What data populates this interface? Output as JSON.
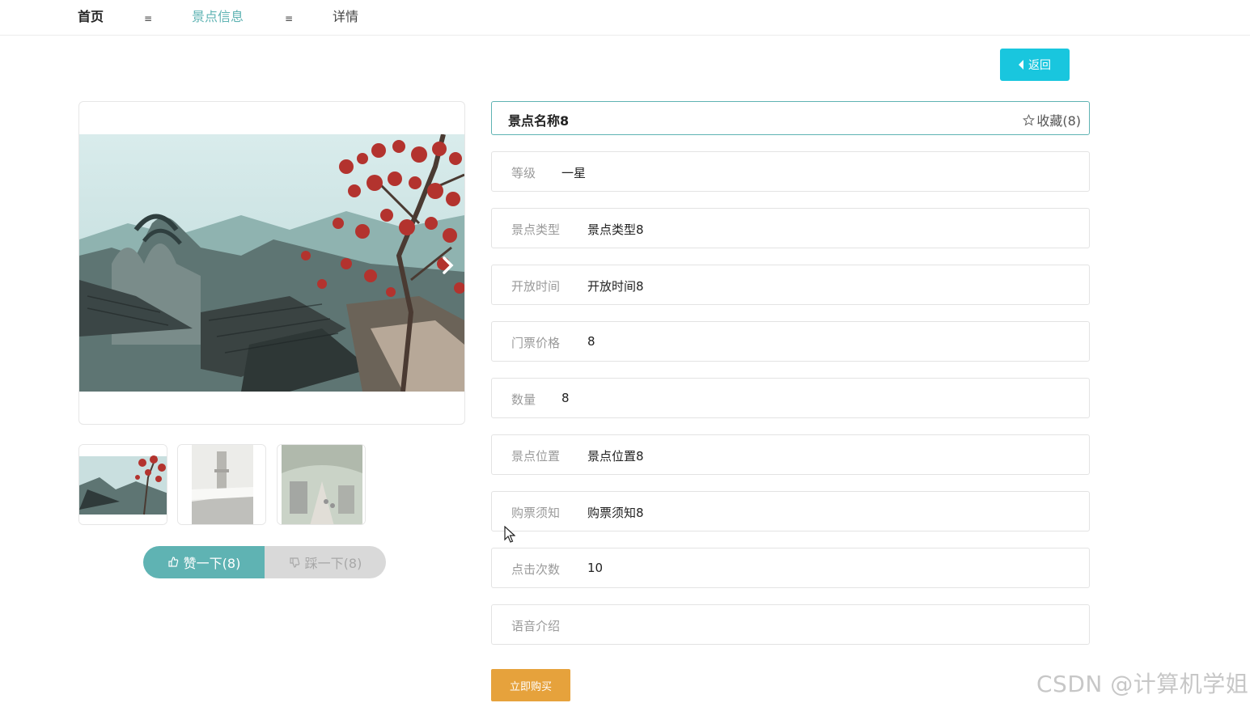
{
  "breadcrumb": {
    "home": "首页",
    "sep1": "≡",
    "section": "景点信息",
    "sep2": "≡",
    "current": "详情"
  },
  "back_button": {
    "label": "返回",
    "icon": "caret-left-icon"
  },
  "gallery": {
    "main_image": "scenic-photo-old-village-red-blossom",
    "next_icon": "chevron-right-icon",
    "thumbnails": [
      "thumb-village-blossom",
      "thumb-tower-fog",
      "thumb-street-trees"
    ]
  },
  "votes": {
    "like_label": "赞一下(8)",
    "like_icon": "thumb-up-icon",
    "dislike_label": "踩一下(8)",
    "dislike_icon": "thumb-down-icon"
  },
  "detail": {
    "name": "景点名称8",
    "favorite_label": "收藏(8)",
    "favorite_icon": "star-outline-icon",
    "fields": [
      {
        "label": "等级",
        "value": "一星"
      },
      {
        "label": "景点类型",
        "value": "景点类型8"
      },
      {
        "label": "开放时间",
        "value": "开放时间8"
      },
      {
        "label": "门票价格",
        "value": "8"
      },
      {
        "label": "数量",
        "value": "8"
      },
      {
        "label": "景点位置",
        "value": "景点位置8"
      },
      {
        "label": "购票须知",
        "value": "购票须知8"
      },
      {
        "label": "点击次数",
        "value": "10"
      },
      {
        "label": "语音介绍",
        "value": ""
      }
    ]
  },
  "buy_button": {
    "label": "立即购买"
  },
  "watermark": "CSDN @计算机学姐",
  "colors": {
    "accent": "#5fb3b3",
    "back_button": "#19c6de",
    "buy_button": "#e6a23c"
  }
}
